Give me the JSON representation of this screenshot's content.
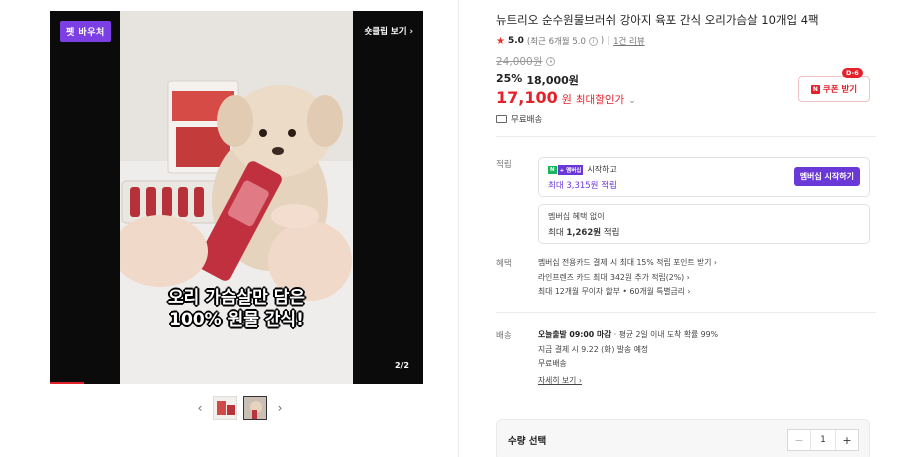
{
  "media": {
    "badge": "펫 바우처",
    "shorts_link": "숏클립 보기 ›",
    "counter": "2/2",
    "caption_line1": "오리 가슴살만 담은",
    "caption_line2": "100% 원물 간식!",
    "progress": 0.09
  },
  "thumbs": {
    "prev": "‹",
    "next": "›"
  },
  "product": {
    "title": "뉴트리오 순수원물브러쉬 강아지 육포 간식 오리가슴살 10개입 4팩",
    "rating_score": "5.0",
    "rating_detail": "(최근 6개월 5.0",
    "review_count": "1건 리뷰",
    "original_price": "24,000원",
    "discount_rate": "25%",
    "sale_price": "18,000원",
    "final_price": "17,100",
    "final_unit": "원",
    "max_discount_label": "최대할인가",
    "free_shipping": "무료배송",
    "coupon_label": "쿠폰 받기",
    "coupon_dday": "D-6"
  },
  "points": {
    "label": "적립",
    "membership_tag_n": "N",
    "membership_tag_plus": "+ 멤버십",
    "membership_start_text": "시작하고",
    "membership_max": "최대 3,315원 적립",
    "membership_button": "멤버십 시작하기",
    "no_membership": "멤버십 혜택 없이",
    "no_membership_max_prefix": "최대 ",
    "no_membership_max_amount": "1,262원",
    "no_membership_max_suffix": " 적립"
  },
  "benefits": {
    "label": "혜택",
    "items": [
      "멤버십 전용카드 결제 시 최대 15% 적립 포인트 받기 ›",
      "라인프렌즈 카드 최대 342원 추가 적립(2%) ›",
      "최대 12개월 무이자 할부 • 60개월 특별금리 ›"
    ]
  },
  "delivery": {
    "label": "배송",
    "line1_bold": "오늘출발 09:00 마감",
    "line1_rest": " · 평균 2일 이내 도착 확률 99%",
    "line2": "지금 결제 시 9.22 (화) 발송 예정",
    "line3": "무료배송",
    "detail_link": "자세히 보기 ›"
  },
  "quantity": {
    "title": "수량 선택",
    "minus": "−",
    "value": "1",
    "plus": "+"
  },
  "colors": {
    "accent_red": "#e5222c",
    "purple": "#6b38d8",
    "naver_green": "#17b75e"
  }
}
